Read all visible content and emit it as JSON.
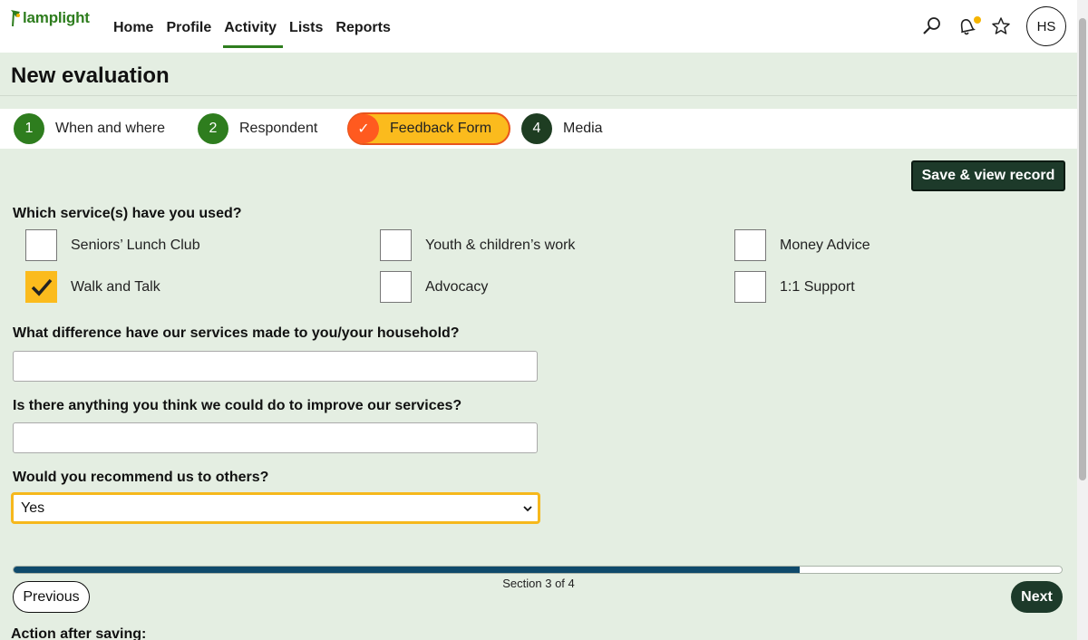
{
  "app": {
    "logo_text": "lamplight",
    "nav": [
      {
        "label": "Home",
        "active": false
      },
      {
        "label": "Profile",
        "active": false
      },
      {
        "label": "Activity",
        "active": true
      },
      {
        "label": "Lists",
        "active": false
      },
      {
        "label": "Reports",
        "active": false
      }
    ],
    "icons": [
      "search-icon",
      "bell-icon",
      "star-icon"
    ],
    "avatar_initials": "HS",
    "accent": "#2e7d1e"
  },
  "page": {
    "title": "New evaluation",
    "steps": [
      {
        "number": "1",
        "label": "When and where",
        "state": "done"
      },
      {
        "number": "2",
        "label": "Respondent",
        "state": "done"
      },
      {
        "number": "✓",
        "label": "Feedback Form",
        "state": "current"
      },
      {
        "number": "4",
        "label": "Media",
        "state": "upcoming"
      }
    ],
    "save_button": "Save & view record"
  },
  "form": {
    "q1": {
      "label": "Which service(s) have you used?",
      "options": [
        {
          "label": "Seniors’ Lunch Club",
          "checked": false
        },
        {
          "label": "Youth & children’s work",
          "checked": false
        },
        {
          "label": "Money Advice",
          "checked": false
        },
        {
          "label": "Walk and Talk",
          "checked": true
        },
        {
          "label": "Advocacy",
          "checked": false
        },
        {
          "label": "1:1 Support",
          "checked": false
        }
      ]
    },
    "q2": {
      "label": "What difference have our services made to you/your household?",
      "value": ""
    },
    "q3": {
      "label": "Is there anything you think we could do to improve our services?",
      "value": ""
    },
    "q4": {
      "label": "Would you recommend us to others?",
      "value": "Yes"
    }
  },
  "progress": {
    "fraction": 0.75,
    "text": "Section 3 of 4"
  },
  "buttons": {
    "previous": "Previous",
    "next": "Next"
  },
  "action_label": "Action after saving:"
}
